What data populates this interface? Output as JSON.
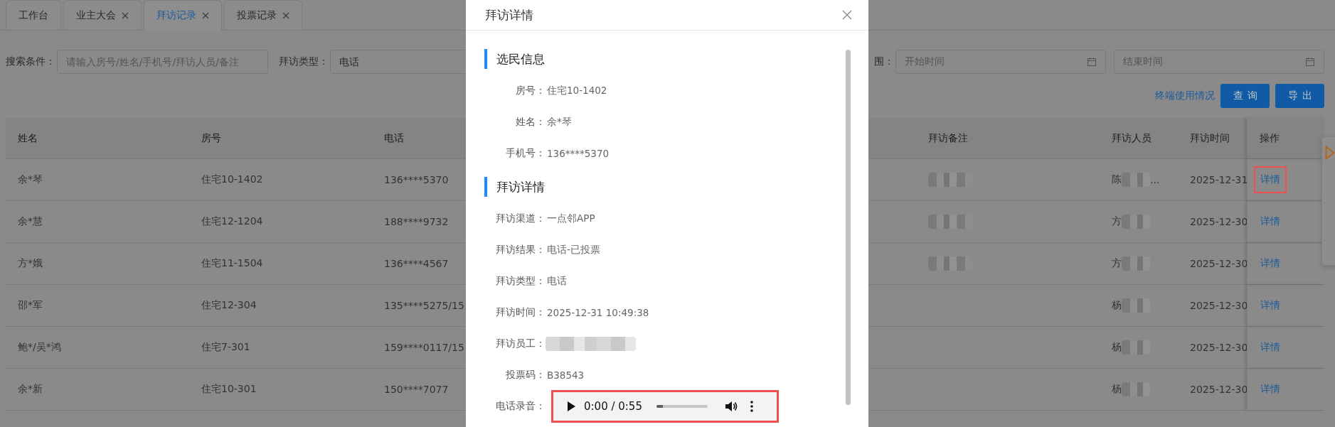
{
  "tabs": [
    {
      "label": "工作台",
      "closable": false,
      "selected": false
    },
    {
      "label": "业主大会",
      "closable": true,
      "selected": false
    },
    {
      "label": "拜访记录",
      "closable": true,
      "selected": true
    },
    {
      "label": "投票记录",
      "closable": true,
      "selected": false
    }
  ],
  "filters": [
    {
      "kind": "text",
      "label": "搜索条件：",
      "placeholder": "请输入房号/姓名/手机号/拜访人员/备注"
    },
    {
      "kind": "select",
      "label": "拜访类型：",
      "value": "电话"
    },
    {
      "kind": "date",
      "label": "围：",
      "placeholder": "开始时间"
    },
    {
      "kind": "date",
      "placeholder": "结束时间"
    }
  ],
  "actions": {
    "link": "终端使用情况",
    "buttons": [
      "查询",
      "导出"
    ]
  },
  "table": {
    "columns": [
      "姓名",
      "房号",
      "电话",
      "",
      "拜访备注",
      "拜访人员",
      "拜访时间",
      "操作"
    ],
    "rows": [
      {
        "name": "余*琴",
        "room": "住宅10-1402",
        "phone": "136****5370",
        "note_redacted": true,
        "visitor": "陈",
        "visitor_redacted": true,
        "visitor_suffix": "...",
        "time": "2025-12-31",
        "action": "详情",
        "highlighted": true
      },
      {
        "name": "余*慧",
        "room": "住宅12-1204",
        "phone": "188****9732",
        "note_redacted": true,
        "visitor": "方",
        "visitor_redacted": true,
        "time": "2025-12-30",
        "action": "详情",
        "highlighted": false
      },
      {
        "name": "方*娥",
        "room": "住宅11-1504",
        "phone": "136****4567",
        "note_redacted": true,
        "visitor": "方",
        "visitor_redacted": true,
        "time": "2025-12-30",
        "action": "详情",
        "highlighted": false
      },
      {
        "name": "邵*军",
        "room": "住宅12-304",
        "phone": "135****5275/15",
        "note_redacted": false,
        "visitor": "杨",
        "visitor_redacted": true,
        "time": "2025-12-30",
        "action": "详情",
        "highlighted": false
      },
      {
        "name": "鲍*/吴*鸿",
        "room": "住宅7-301",
        "phone": "159****0117/15",
        "note_redacted": false,
        "visitor": "杨",
        "visitor_redacted": true,
        "time": "2025-12-30",
        "action": "详情",
        "highlighted": false
      },
      {
        "name": "余*新",
        "room": "住宅10-301",
        "phone": "150****7077",
        "note_redacted": false,
        "visitor": "杨",
        "visitor_redacted": true,
        "time": "2025-12-30",
        "action": "详情",
        "highlighted": false
      }
    ]
  },
  "modal": {
    "title": "拜访详情",
    "sections": [
      {
        "title": "选民信息",
        "fields": [
          {
            "kind": "text",
            "label": "房号：",
            "value": "住宅10-1402"
          },
          {
            "kind": "text",
            "label": "姓名：",
            "value": "余*琴"
          },
          {
            "kind": "text",
            "label": "手机号：",
            "value": "136****5370"
          }
        ]
      },
      {
        "title": "拜访详情",
        "fields": [
          {
            "kind": "text",
            "label": "拜访渠道：",
            "value": "一点邻APP"
          },
          {
            "kind": "text",
            "label": "拜访结果：",
            "value": "电话-已投票"
          },
          {
            "kind": "text",
            "label": "拜访类型：",
            "value": "电话"
          },
          {
            "kind": "text",
            "label": "拜访时间：",
            "value": "2025-12-31 10:49:38"
          },
          {
            "kind": "redacted",
            "label": "拜访员工："
          },
          {
            "kind": "text",
            "label": "投票码：",
            "value": "B38543"
          },
          {
            "kind": "audio",
            "label": "电话录音：",
            "time": "0:00 / 0:55",
            "level": 0.13,
            "highlighted": true
          }
        ]
      }
    ]
  }
}
